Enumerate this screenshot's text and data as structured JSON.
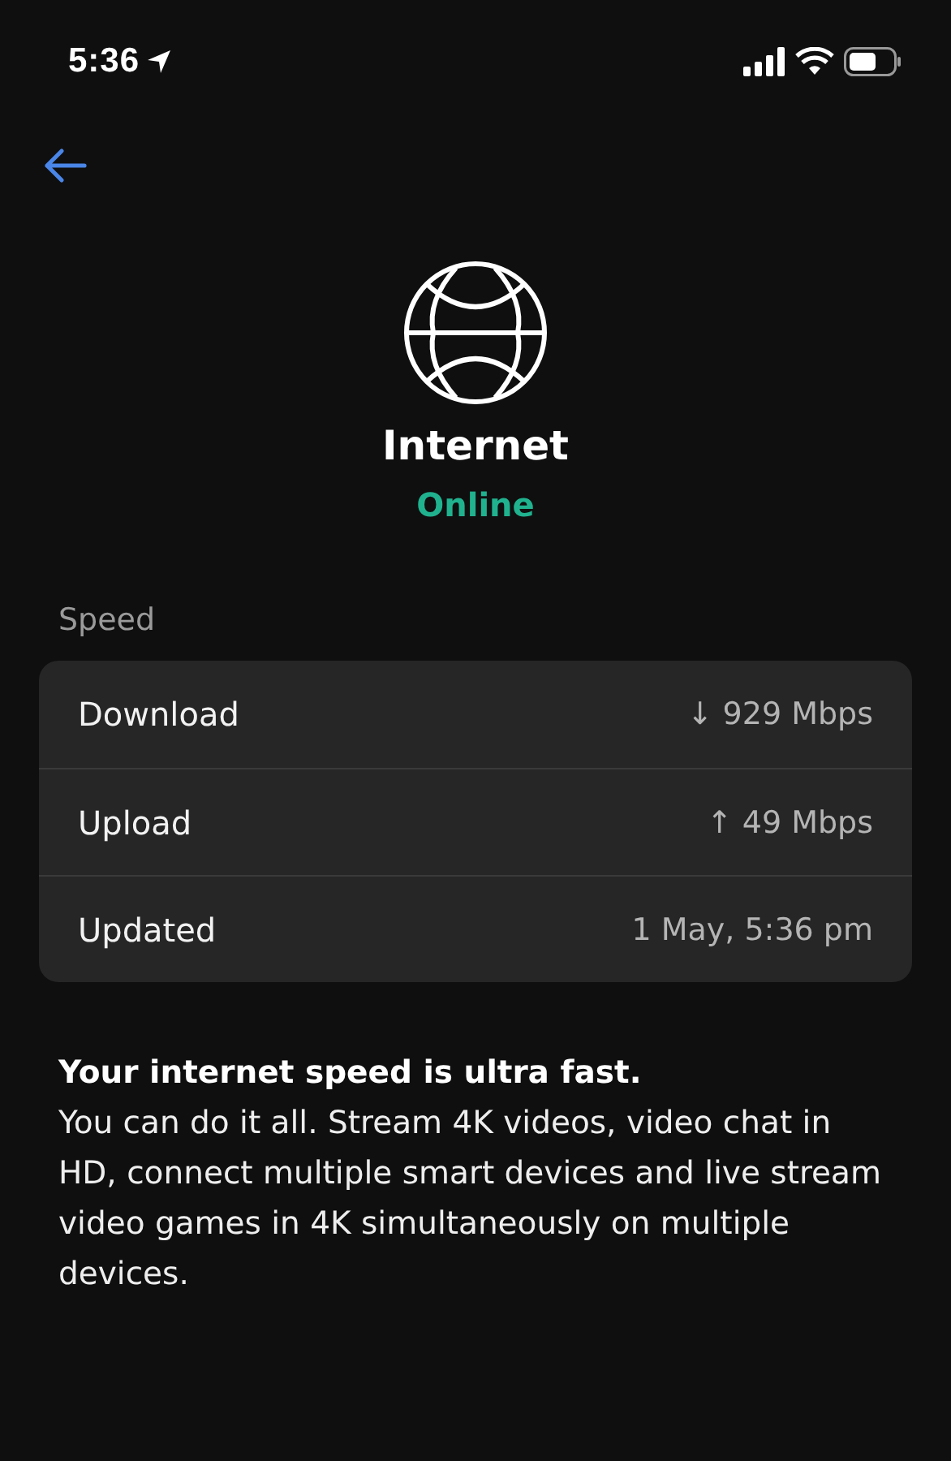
{
  "status_bar": {
    "time": "5:36"
  },
  "header": {
    "title": "Internet",
    "status": "Online"
  },
  "speed": {
    "label": "Speed",
    "rows": [
      {
        "label": "Download",
        "value": "↓ 929 Mbps"
      },
      {
        "label": "Upload",
        "value": "↑ 49 Mbps"
      },
      {
        "label": "Updated",
        "value": "1 May, 5:36 pm"
      }
    ]
  },
  "summary": {
    "title": "Your internet speed is ultra fast.",
    "text": "You can do it all. Stream 4K videos, video chat in HD, connect multiple smart devices and live stream video games in 4K simultaneously on multiple devices."
  }
}
